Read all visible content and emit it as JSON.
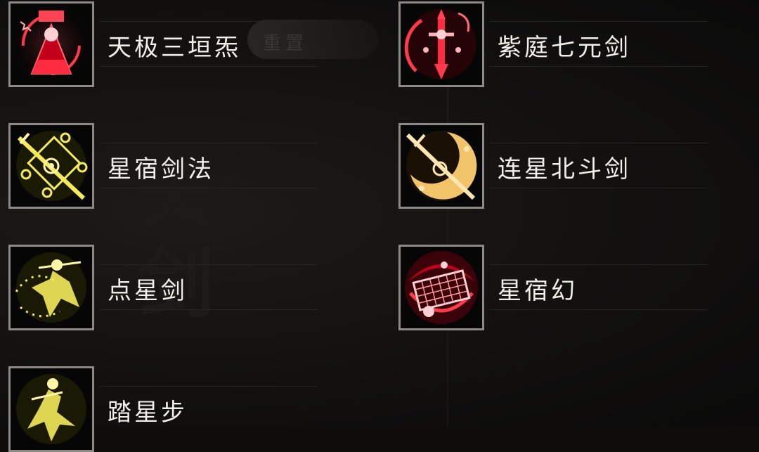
{
  "faded_label": "重置",
  "watermark_text": "天剑",
  "skills": [
    {
      "name": "天极三垣炁",
      "icon": "warrior-seal-icon",
      "color": "#e8283a",
      "glow": "red"
    },
    {
      "name": "紫庭七元剑",
      "icon": "red-sword-icon",
      "color": "#e8283a",
      "glow": "red"
    },
    {
      "name": "星宿剑法",
      "icon": "constellation-sword-icon",
      "color": "#f2e24a",
      "glow": "yellow"
    },
    {
      "name": "连星北斗剑",
      "icon": "crescent-sword-icon",
      "color": "#f2c46a",
      "glow": "orange"
    },
    {
      "name": "点星剑",
      "icon": "swordsman-icon",
      "color": "#f2e24a",
      "glow": "yellow"
    },
    {
      "name": "星宿幻",
      "icon": "star-board-icon",
      "color": "#e8283a",
      "glow": "red"
    },
    {
      "name": "踏星步",
      "icon": "dancer-icon",
      "color": "#f2e24a",
      "glow": "yellow"
    }
  ]
}
